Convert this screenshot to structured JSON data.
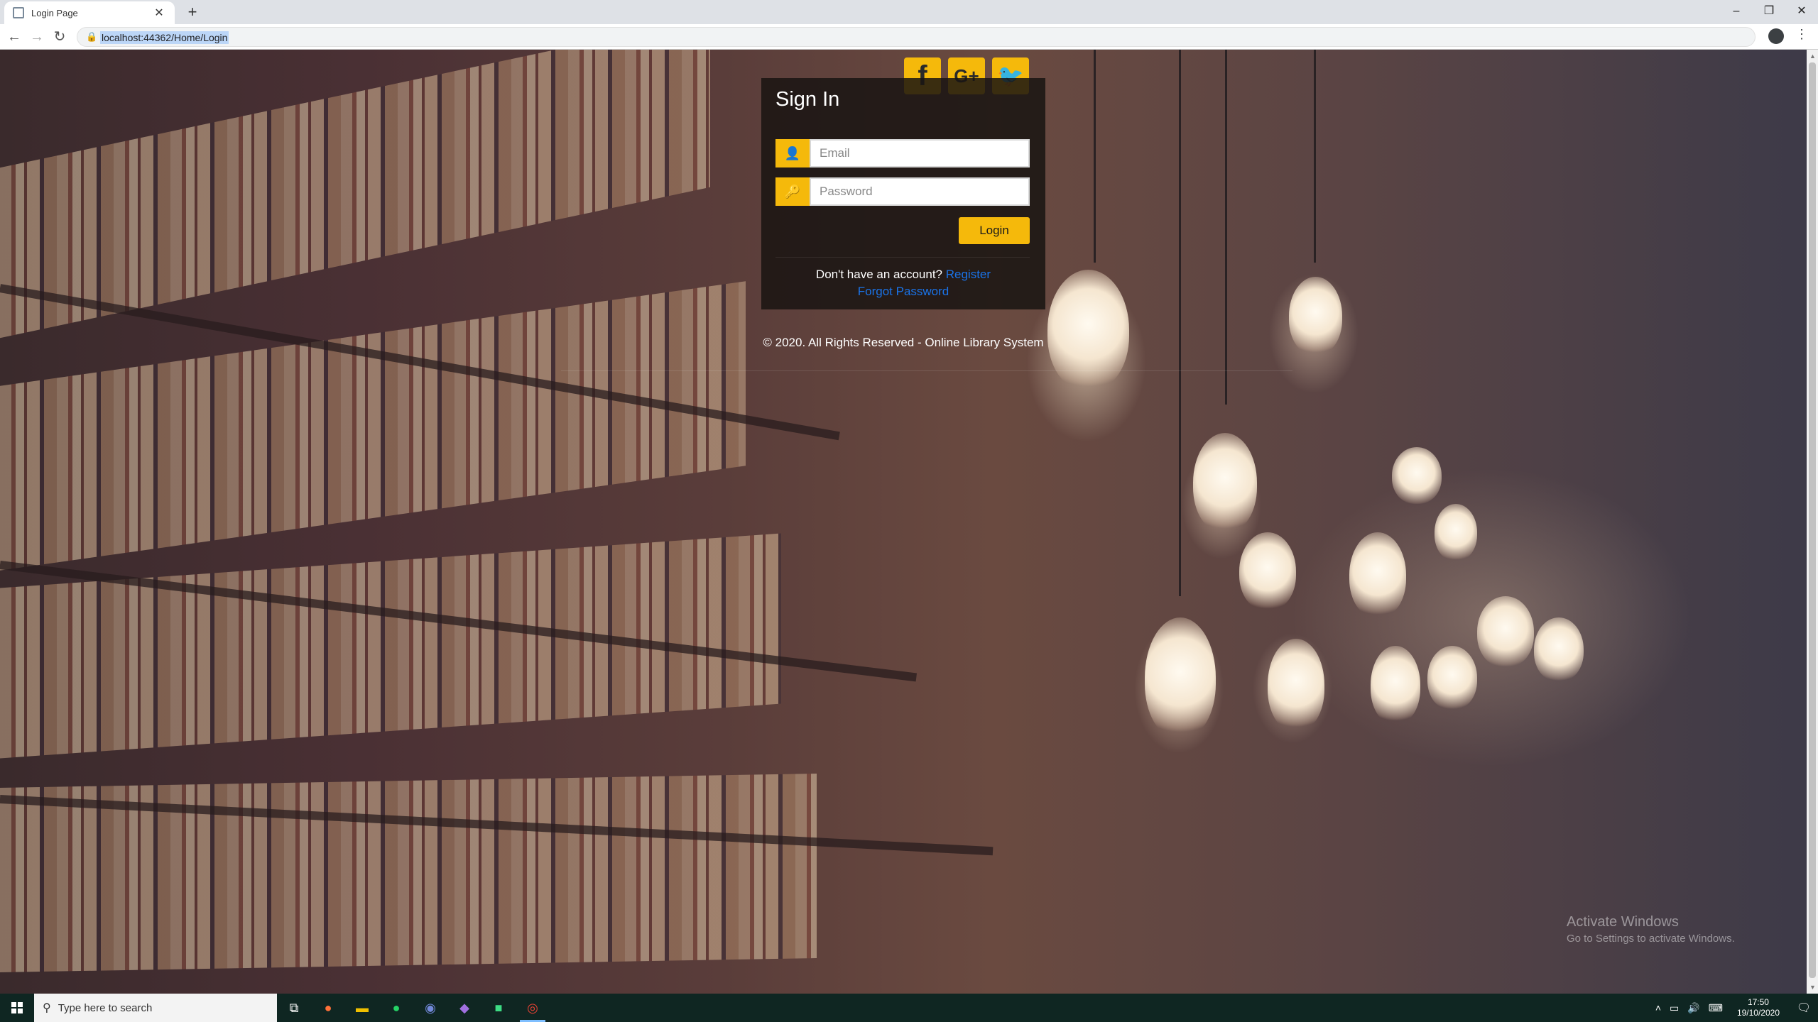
{
  "browser": {
    "tab_title": "Login Page",
    "tab_close": "✕",
    "new_tab": "+",
    "url": "localhost:44362/Home/Login",
    "window_controls": {
      "minimize": "–",
      "restore": "❐",
      "close": "✕"
    }
  },
  "social": {
    "facebook": "f",
    "google_plus": "G+",
    "twitter": "🐦"
  },
  "login": {
    "title": "Sign In",
    "email_placeholder": "Email",
    "password_placeholder": "Password",
    "login_button": "Login",
    "no_account_text": "Don't have an account?",
    "register_link": "Register",
    "forgot_link": "Forgot Password"
  },
  "footer": {
    "copyright": "© 2020. All Rights Reserved - Online Library System"
  },
  "watermark": {
    "title": "Activate Windows",
    "subtitle": "Go to Settings to activate Windows."
  },
  "taskbar": {
    "search_placeholder": "Type here to search",
    "time": "17:50",
    "date": "19/10/2020"
  },
  "colors": {
    "accent": "#f5b90b",
    "link": "#1a73e8",
    "card_bg": "rgba(25,20,18,0.85)"
  }
}
